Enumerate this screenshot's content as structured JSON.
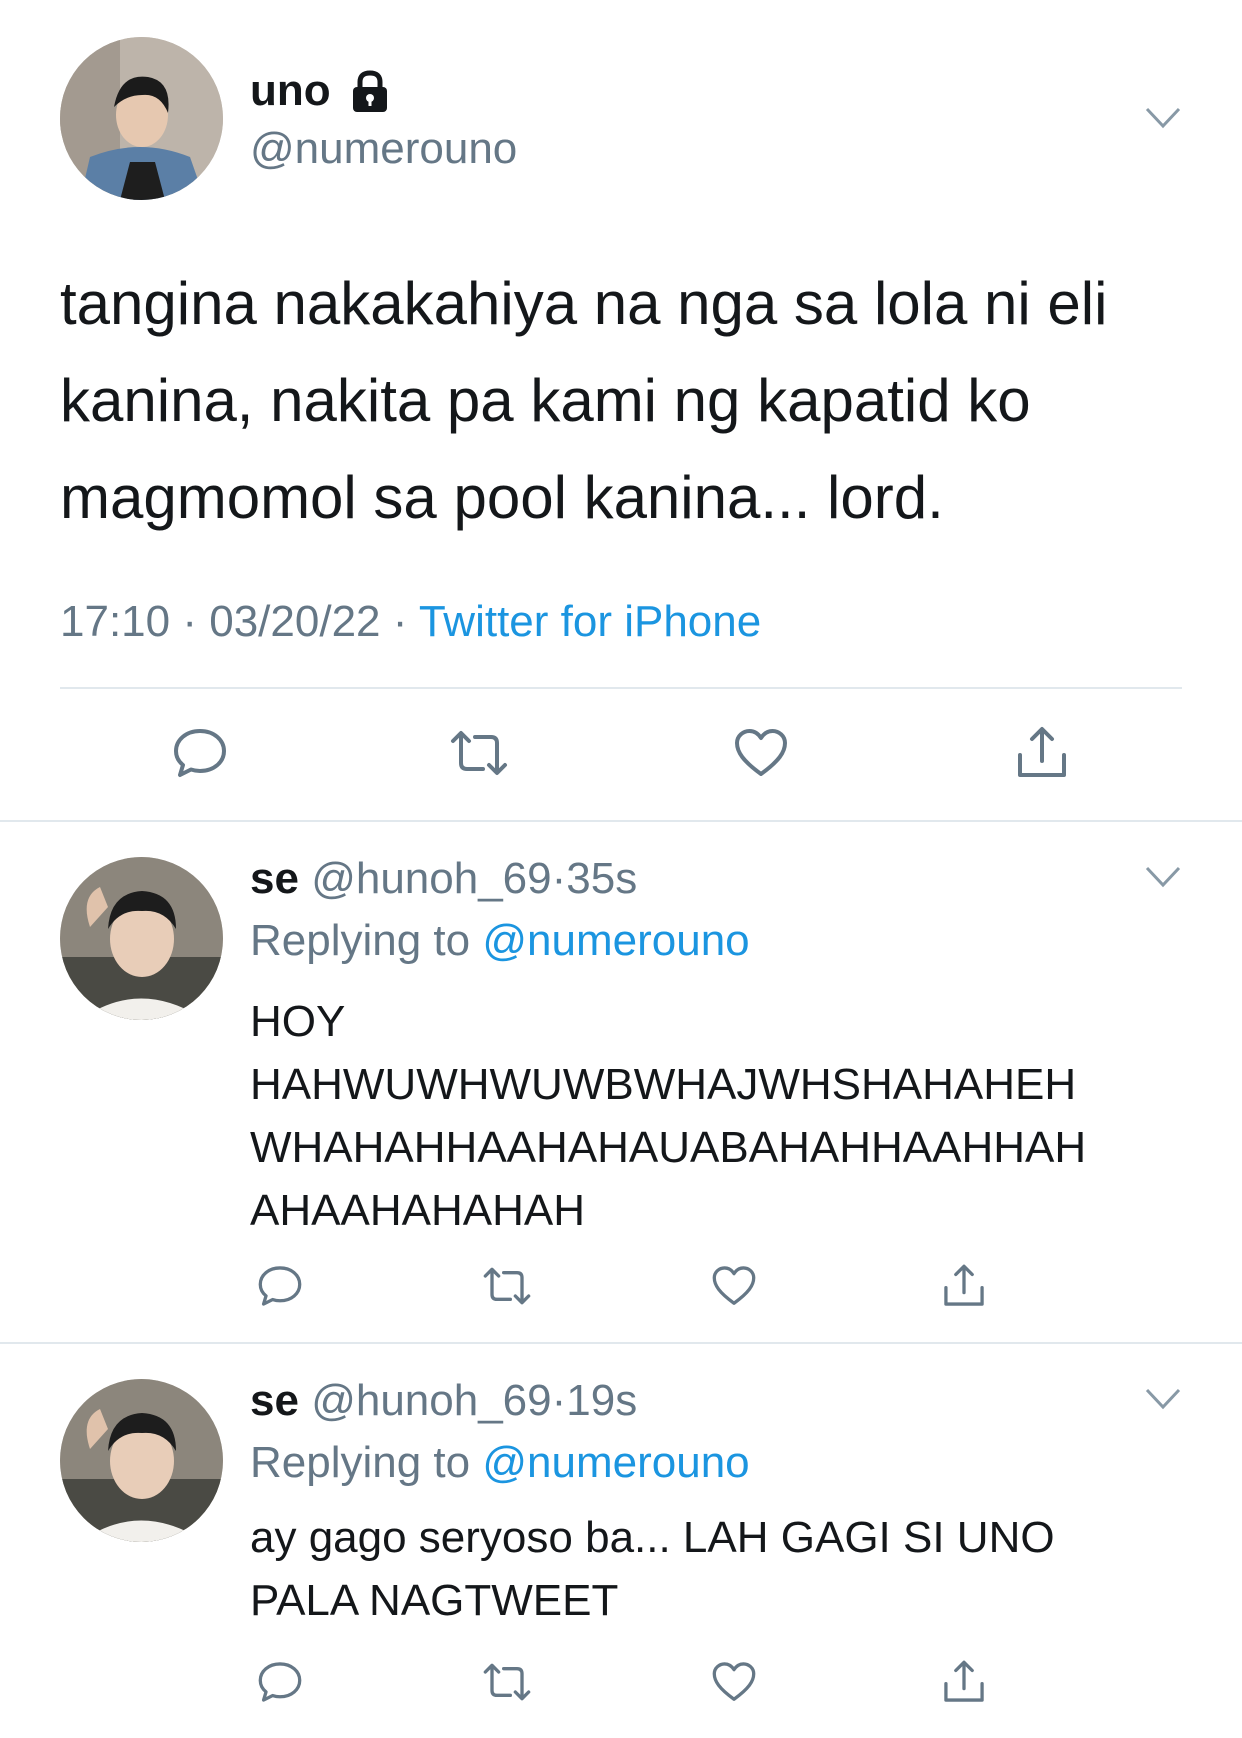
{
  "main_tweet": {
    "display_name": "uno",
    "handle": "@numerouno",
    "lines": [
      "tangina nakakahiya na nga sa lola ni eli",
      "kanina, nakita pa kami ng kapatid ko",
      "magmomol sa pool kanina... lord."
    ],
    "time": "17:10",
    "date": "03/20/22",
    "separator": "·",
    "source": "Twitter for iPhone"
  },
  "replies": [
    {
      "display_name": "se",
      "handle": "@hunoh_69",
      "separator": "·",
      "age": "35s",
      "replying_label": "Replying to",
      "replying_to": "@numerouno",
      "lines": [
        "HOY",
        "HAHWUWHWUWBWHAJWHSHAHAHEH",
        "WHAHAHHAAHAHAUABAHAHHAAHHAH",
        "AHAAHAHAHAH"
      ]
    },
    {
      "display_name": "se",
      "handle": "@hunoh_69",
      "separator": "·",
      "age": "19s",
      "replying_label": "Replying to",
      "replying_to": "@numerouno",
      "lines": [
        "ay gago seryoso ba... LAH GAGI SI UNO",
        "PALA NAGTWEET"
      ]
    }
  ],
  "icons": {
    "lock": "lock-icon",
    "chevron": "chevron-down-icon",
    "reply": "reply-icon",
    "retweet": "retweet-icon",
    "like": "heart-icon",
    "share": "share-icon"
  },
  "colors": {
    "text": "#14171a",
    "secondary": "#657786",
    "link": "#1b95e0",
    "divider": "#e1e8ed"
  }
}
